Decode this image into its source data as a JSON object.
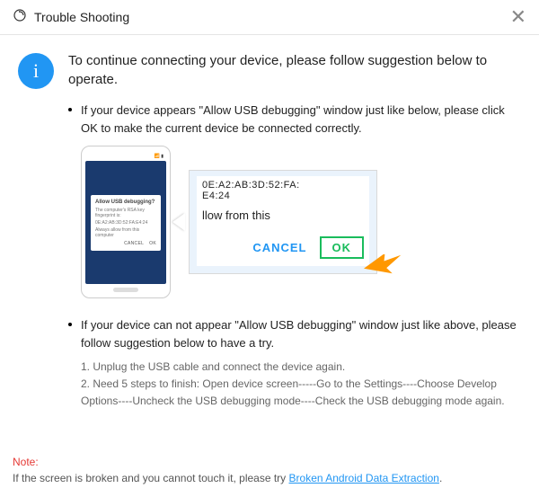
{
  "titlebar": {
    "title": "Trouble Shooting"
  },
  "heading": "To continue connecting your device, please follow suggestion below to operate.",
  "bullet1": "If your device appears \"Allow USB debugging\" window just like below, please click OK to make the current device  be connected correctly.",
  "bullet2": "If your device can not appear \"Allow USB debugging\" window just like above, please follow suggestion below to have a try.",
  "phone_dialog": {
    "title": "Allow USB debugging?",
    "line1": "The computer's RSA key fingerprint is:",
    "line2": "0E:A2:AB:3D:52:FA:E4:24",
    "check": "Always allow from this computer",
    "cancel": "CANCEL",
    "ok": "OK"
  },
  "zoom": {
    "fp1": "0E:A2:AB:3D:52:FA:",
    "fp2": "E4:24",
    "allow": "llow from this",
    "cancel": "CANCEL",
    "ok": "OK"
  },
  "steps": {
    "s1": "1. Unplug the USB cable and connect the device again.",
    "s2": "2. Need 5 steps to finish: Open device screen-----Go to the Settings----Choose Develop Options----Uncheck the USB debugging mode----Check the USB debugging mode again."
  },
  "footer": {
    "note": "Note:",
    "text": "If the screen is broken and you cannot touch it, please try ",
    "link": "Broken Android Data Extraction",
    "dot": "."
  }
}
